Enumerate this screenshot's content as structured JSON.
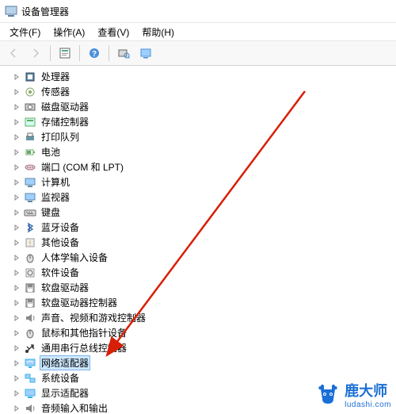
{
  "window": {
    "title": "设备管理器"
  },
  "menus": [
    {
      "label": "文件(F)"
    },
    {
      "label": "操作(A)"
    },
    {
      "label": "查看(V)"
    },
    {
      "label": "帮助(H)"
    }
  ],
  "toolbar": {
    "back_tip": "后退",
    "fwd_tip": "前进",
    "props_tip": "属性",
    "help_tip": "帮助",
    "scan_tip": "扫描检测硬件改动",
    "view_tip": "查看"
  },
  "tree": [
    {
      "label": "处理器",
      "icon": "cpu"
    },
    {
      "label": "传感器",
      "icon": "sensor"
    },
    {
      "label": "磁盘驱动器",
      "icon": "disk"
    },
    {
      "label": "存储控制器",
      "icon": "storage"
    },
    {
      "label": "打印队列",
      "icon": "printer"
    },
    {
      "label": "电池",
      "icon": "battery"
    },
    {
      "label": "端口 (COM 和 LPT)",
      "icon": "port"
    },
    {
      "label": "计算机",
      "icon": "computer"
    },
    {
      "label": "监视器",
      "icon": "monitor"
    },
    {
      "label": "键盘",
      "icon": "keyboard"
    },
    {
      "label": "蓝牙设备",
      "icon": "bluetooth"
    },
    {
      "label": "其他设备",
      "icon": "other"
    },
    {
      "label": "人体学输入设备",
      "icon": "hid"
    },
    {
      "label": "软件设备",
      "icon": "software"
    },
    {
      "label": "软盘驱动器",
      "icon": "floppy"
    },
    {
      "label": "软盘驱动器控制器",
      "icon": "floppyctl"
    },
    {
      "label": "声音、视频和游戏控制器",
      "icon": "audio"
    },
    {
      "label": "鼠标和其他指针设备",
      "icon": "mouse"
    },
    {
      "label": "通用串行总线控制器",
      "icon": "usb"
    },
    {
      "label": "网络适配器",
      "icon": "network",
      "selected": true
    },
    {
      "label": "系统设备",
      "icon": "system"
    },
    {
      "label": "显示适配器",
      "icon": "display"
    },
    {
      "label": "音频输入和输出",
      "icon": "audioio"
    }
  ],
  "watermark": {
    "brand": "鹿大师",
    "url": "ludashi.com"
  },
  "colors": {
    "arrow": "#d81e06",
    "sel_bg": "#cde8ff",
    "sel_border": "#7eb4ea",
    "brand": "#1a6fd6"
  }
}
